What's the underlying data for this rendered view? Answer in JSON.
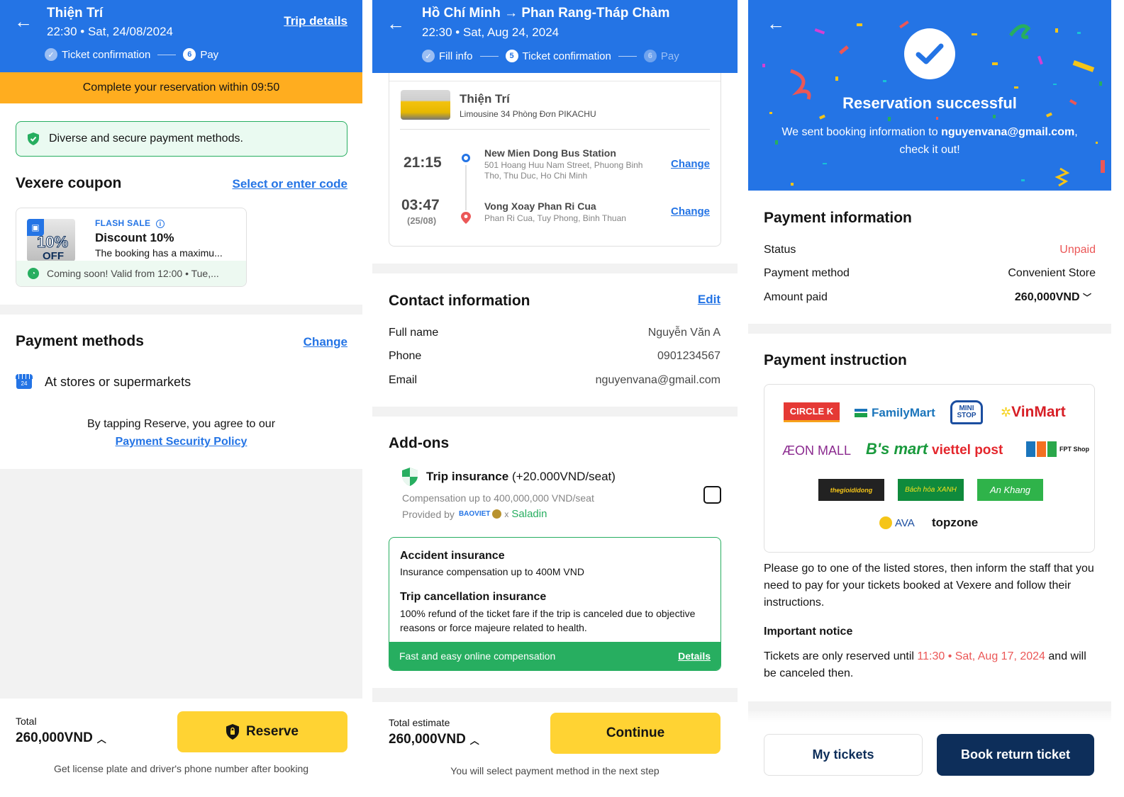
{
  "panel1": {
    "header": {
      "title": "Thiện Trí",
      "subtitle": "22:30 • Sat, 24/08/2024",
      "trip_details_link": "Trip details",
      "steps": [
        {
          "label": "Ticket confirmation",
          "state": "done",
          "number": "✓"
        },
        {
          "label": "Pay",
          "state": "active",
          "number": "6"
        }
      ]
    },
    "timer_banner": "Complete your reservation within 09:50",
    "secure_notice": "Diverse and secure payment methods.",
    "coupon": {
      "section_title": "Vexere coupon",
      "select_link": "Select or enter code",
      "card": {
        "image_text_top": "10%",
        "image_text_bottom": "OFF",
        "tag": "FLASH SALE",
        "title": "Discount 10%",
        "description": "The booking has a maximu...",
        "validity": "Coming soon! Valid from 12:00 • Tue,..."
      }
    },
    "payment_methods": {
      "section_title": "Payment methods",
      "change_link": "Change",
      "selected": "At stores or supermarkets",
      "store_icon_text": "24"
    },
    "agreement": {
      "text": "By tapping Reserve, you agree to our",
      "policy_link": "Payment Security Policy"
    },
    "footer": {
      "total_label": "Total",
      "total_value": "260,000VND",
      "reserve_button": "Reserve",
      "note": "Get license plate and driver's phone number after booking"
    }
  },
  "panel2": {
    "header": {
      "title": "Hồ Chí Minh → Phan Rang-Tháp Chàm",
      "subtitle": "22:30 • Sat, Aug 24, 2024",
      "steps": [
        {
          "label": "Fill info",
          "state": "done",
          "number": "✓"
        },
        {
          "label": "Ticket confirmation",
          "state": "active",
          "number": "5"
        },
        {
          "label": "Pay",
          "state": "pending",
          "number": "6"
        }
      ]
    },
    "trip": {
      "operator": "Thiện Trí",
      "vehicle": "Limousine 34 Phòng Đơn PIKACHU",
      "pickup": {
        "time": "21:15",
        "name": "New Mien Dong Bus Station",
        "address": "501 Hoang Huu Nam Street, Phuong Binh Tho, Thu Duc, Ho Chi Minh",
        "change_link": "Change"
      },
      "dropoff": {
        "time": "03:47",
        "date": "(25/08)",
        "name": "Vong Xoay Phan Ri Cua",
        "address": "Phan Ri Cua, Tuy Phong, Binh Thuan",
        "change_link": "Change"
      }
    },
    "contact": {
      "section_title": "Contact information",
      "edit_link": "Edit",
      "rows": [
        {
          "label": "Full name",
          "value": "Nguyễn Văn A"
        },
        {
          "label": "Phone",
          "value": "0901234567"
        },
        {
          "label": "Email",
          "value": "nguyenvana@gmail.com"
        }
      ]
    },
    "addons": {
      "section_title": "Add-ons",
      "insurance_title": "Trip insurance",
      "insurance_price": "(+20.000VND/seat)",
      "compensation": "Compensation up to 400,000,000 VND/seat",
      "provided_by": "Provided by",
      "provider_1": "BAOVIET",
      "provider_x": "x",
      "provider_2": "Saladin",
      "checked": false,
      "details_card": {
        "accident_title": "Accident insurance",
        "accident_desc": "Insurance compensation up to 400M VND",
        "cancel_title": "Trip cancellation insurance",
        "cancel_desc": "100% refund of the ticket fare if the trip is canceled due to objective reasons or force majeure related to health.",
        "footer_text": "Fast and easy online compensation",
        "details_link": "Details"
      }
    },
    "footer": {
      "total_label": "Total estimate",
      "total_value": "260,000VND",
      "continue_button": "Continue",
      "note": "You will select payment method in the next step"
    }
  },
  "panel3": {
    "hero": {
      "title": "Reservation successful",
      "message_prefix": "We sent booking information to",
      "email": "nguyenvana@gmail.com",
      "message_suffix": ",",
      "message_line2": "check it out!"
    },
    "payment_info": {
      "section_title": "Payment information",
      "rows": [
        {
          "label": "Status",
          "value": "Unpaid"
        },
        {
          "label": "Payment method",
          "value": "Convenient Store"
        },
        {
          "label": "Amount paid",
          "value": "260,000VND"
        }
      ]
    },
    "instruction": {
      "section_title": "Payment instruction",
      "stores": [
        "CIRCLE K",
        "FamilyMart",
        "MINI STOP",
        "VinMart",
        "ÆON MALL",
        "B's mart",
        "viettel post",
        "FPT Shop",
        "thegioididong",
        "Bách hóa XANH",
        "An Khang",
        "AVA",
        "topzone"
      ],
      "text": "Please go to one of the listed stores, then inform the staff that you need to pay for your tickets booked at Vexere and follow their instructions.",
      "notice_title": "Important notice",
      "notice_prefix": "Tickets are only reserved until",
      "notice_deadline": "11:30 • Sat, Aug 17, 2024",
      "notice_suffix": "and will be canceled then."
    },
    "footer": {
      "my_tickets_button": "My tickets",
      "book_return_button": "Book return ticket"
    }
  },
  "colors": {
    "brand_blue": "#2474e5",
    "warning_orange": "#ffad1f",
    "cta_yellow": "#ffd333",
    "success_green": "#27ae60",
    "danger_red": "#eb5757",
    "navy": "#0d2e5a"
  }
}
